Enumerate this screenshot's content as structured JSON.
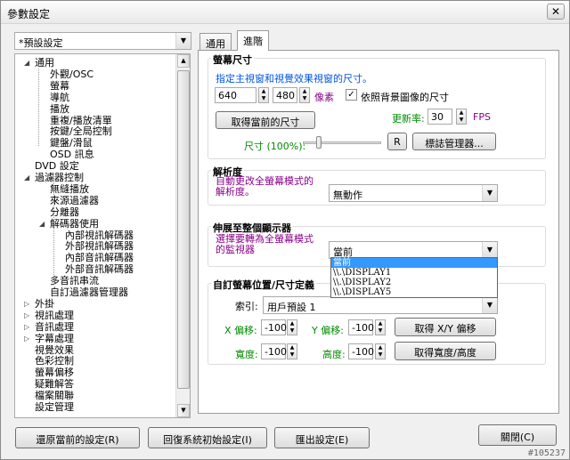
{
  "window": {
    "title": "參數設定",
    "close": "✕"
  },
  "preset": {
    "value": "*預設設定"
  },
  "tree": {
    "items": [
      {
        "label": "通用",
        "toggle": "◢"
      },
      {
        "label": "外觀/OSC"
      },
      {
        "label": "螢幕"
      },
      {
        "label": "導航"
      },
      {
        "label": "播放"
      },
      {
        "label": "重複/播放清單"
      },
      {
        "label": "按鍵/全局控制"
      },
      {
        "label": "鍵盤/滑鼠"
      },
      {
        "label": "OSD 訊息"
      },
      {
        "label": "DVD 設定"
      },
      {
        "label": "過濾器控制",
        "toggle": "◢"
      },
      {
        "label": "無縫播放"
      },
      {
        "label": "來源過濾器"
      },
      {
        "label": "分離器"
      },
      {
        "label": "解碼器使用",
        "toggle": "◢"
      },
      {
        "label": "內部視訊解碼器"
      },
      {
        "label": "外部視訊解碼器"
      },
      {
        "label": "內部音訊解碼器"
      },
      {
        "label": "外部音訊解碼器"
      },
      {
        "label": "多音訊串流"
      },
      {
        "label": "自訂過濾器管理器"
      },
      {
        "label": "外掛",
        "toggle": "▷"
      },
      {
        "label": "視訊處理",
        "toggle": "▷"
      },
      {
        "label": "音訊處理",
        "toggle": "▷"
      },
      {
        "label": "字幕處理",
        "toggle": "▷"
      },
      {
        "label": "視覺效果"
      },
      {
        "label": "色彩控制"
      },
      {
        "label": "螢幕偏移"
      },
      {
        "label": "疑難解答"
      },
      {
        "label": "檔案關聯"
      },
      {
        "label": "設定管理"
      }
    ]
  },
  "tabs": [
    {
      "label": "通用"
    },
    {
      "label": "進階"
    }
  ],
  "screen_size": {
    "title": "螢幕尺寸",
    "desc": "指定主視窗和視覺效果視窗的尺寸。",
    "width": "640",
    "x_label": "X",
    "height": "480",
    "unit": "像素",
    "keep_bg_label": "依照背景圖像的尺寸",
    "keep_bg_checked": "✓",
    "get_current": "取得當前的尺寸",
    "refresh_label": "更新率:",
    "refresh_value": "30",
    "fps": "FPS",
    "size_label": "尺寸 (100%):",
    "r_button": "R",
    "tag_manager": "標誌管理器..."
  },
  "resolution": {
    "title": "解析度",
    "desc": "自動更改全螢幕模式的解析度。",
    "value": "無動作"
  },
  "stretch": {
    "title": "伸展至整個顯示器",
    "desc": "選擇要轉為全螢幕模式的監視器",
    "value": "當前",
    "options": [
      "當前",
      "\\\\.\\DISPLAY1",
      "\\\\.\\DISPLAY2",
      "\\\\.\\DISPLAY5"
    ]
  },
  "custom_pos": {
    "title": "自訂螢幕位置/尺寸定義",
    "index_label": "索引:",
    "index_value": "用戶預設 1",
    "x_label": "X 偏移:",
    "x_value": "-100",
    "y_label": "Y 偏移:",
    "y_value": "-100",
    "get_xy": "取得 X/Y 偏移",
    "w_label": "寬度:",
    "w_value": "-100",
    "h_label": "高度:",
    "h_value": "-100",
    "get_wh": "取得寬度/高度"
  },
  "bottom": {
    "restore": "還原當前的設定(R)",
    "reset": "回復系統初始設定(I)",
    "export": "匯出設定(E)",
    "close": "關閉(C)"
  },
  "watermark": "#105237"
}
